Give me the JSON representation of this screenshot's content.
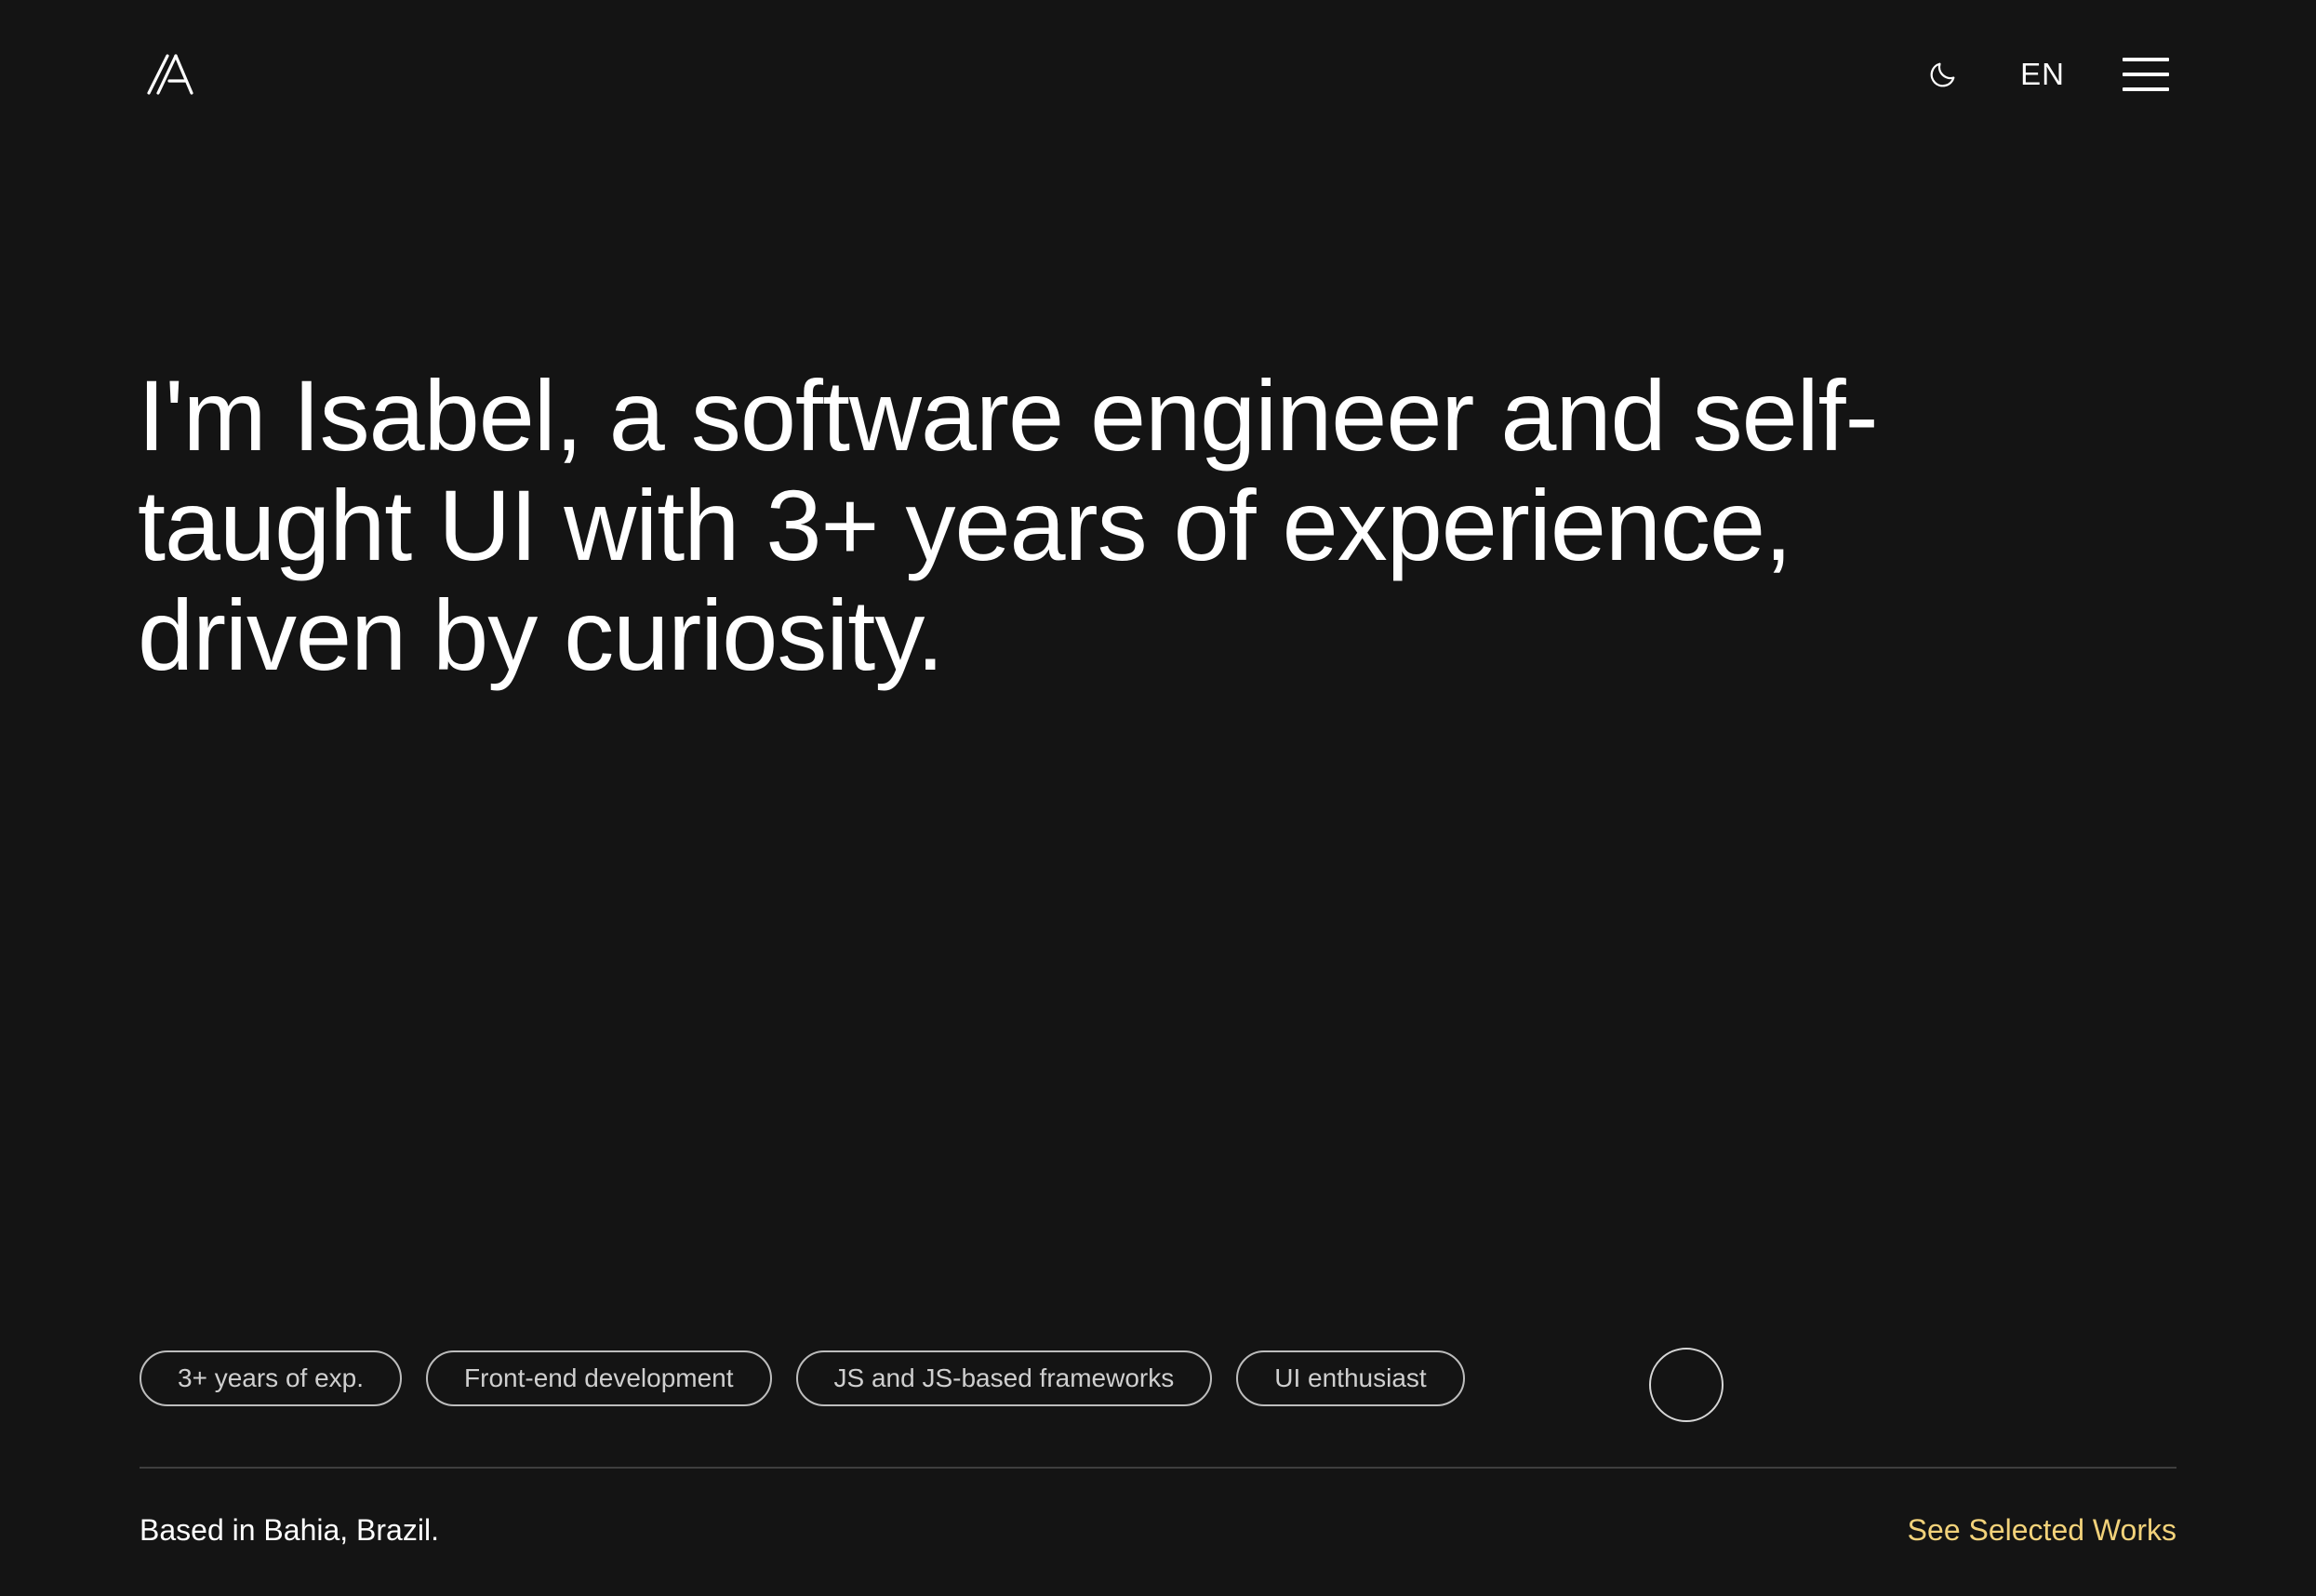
{
  "header": {
    "logo_icon": "slashed-a-monogram-icon",
    "theme_icon": "moon-icon",
    "language": "EN",
    "menu_icon": "hamburger-menu-icon"
  },
  "hero": {
    "headline": "I'm Isabel, a software engineer and self-taught UI with 3+ years of experience, driven by curiosity."
  },
  "tags": [
    "3+ years of exp.",
    "Front-end development",
    "JS and JS-based frameworks",
    "UI enthusiast"
  ],
  "footer": {
    "location": "Based in Bahia, Brazil.",
    "works_link": "See Selected Works"
  },
  "colors": {
    "background": "#141414",
    "text": "#ffffff",
    "accent": "#f2d27a",
    "tag_border": "#bdbdbd",
    "divider": "#3e3e3e"
  }
}
